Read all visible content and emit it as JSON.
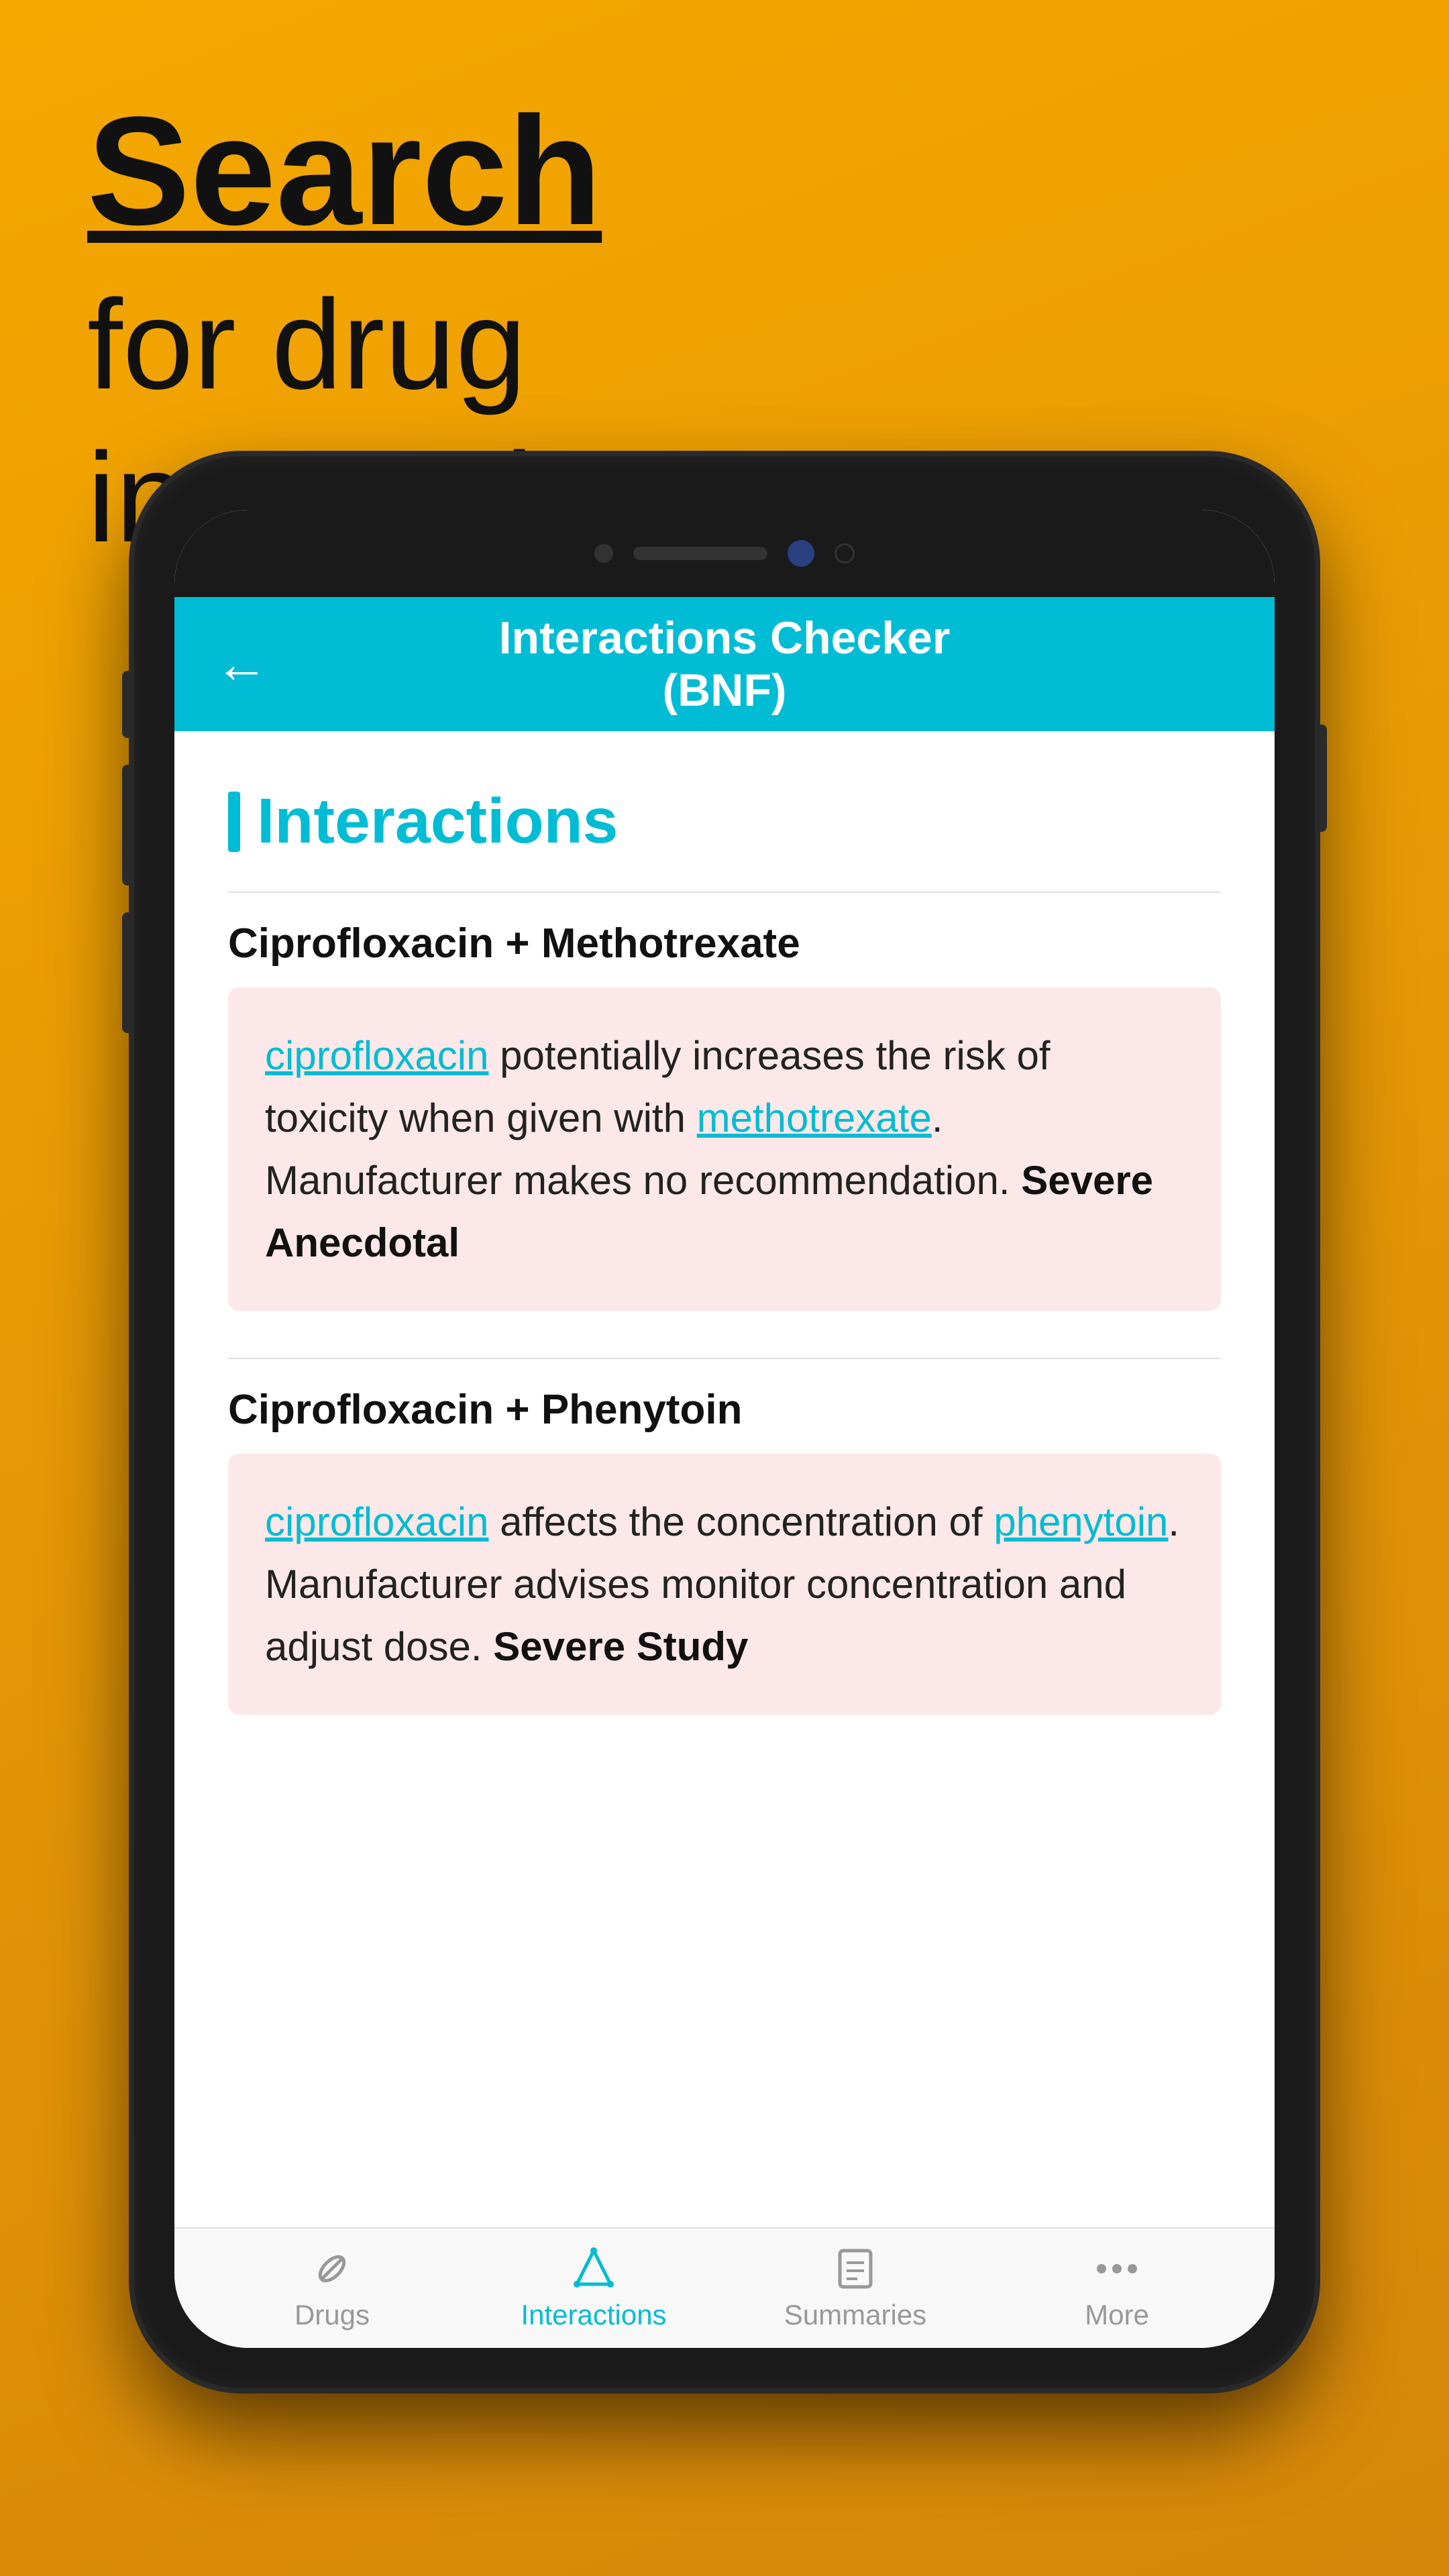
{
  "background": {
    "color_top": "#F5A800",
    "color_bottom": "#D4860A"
  },
  "header": {
    "search_label": "Search",
    "subtitle": "for drug\ninteractions"
  },
  "phone": {
    "app_bar": {
      "title_line1": "Interactions Checker",
      "title_line2": "(BNF)",
      "back_icon": "←"
    },
    "content": {
      "section_title": "Interactions",
      "interactions": [
        {
          "title": "Ciprofloxacin + Methotrexate",
          "drug1": "ciprofloxacin",
          "text": " potentially increases the risk of toxicity when given with ",
          "drug2": "methotrexate",
          "text2": ". Manufacturer makes no recommendation.",
          "severity": "Severe Anecdotal"
        },
        {
          "title": "Ciprofloxacin + Phenytoin",
          "drug1": "ciprofloxacin",
          "text": " affects the concentration of ",
          "drug2": "phenytoin",
          "text2": ". Manufacturer advises monitor concentration and adjust dose.",
          "severity": "Severe Study"
        }
      ]
    },
    "bottom_nav": {
      "items": [
        {
          "id": "drugs",
          "label": "Drugs",
          "active": false
        },
        {
          "id": "interactions",
          "label": "Interactions",
          "active": true
        },
        {
          "id": "summaries",
          "label": "Summaries",
          "active": false
        },
        {
          "id": "more",
          "label": "More",
          "active": false
        }
      ]
    }
  }
}
